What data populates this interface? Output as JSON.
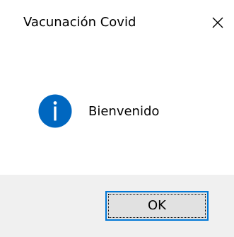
{
  "window": {
    "title": "Vacunación Covid",
    "close_glyph": "✕"
  },
  "content": {
    "icon": "info-icon",
    "message": "Bienvenido"
  },
  "footer": {
    "ok_label": "OK"
  },
  "colors": {
    "icon_fill": "#0067c0",
    "focus_border": "#0078d7",
    "footer_bg": "#f0f0f0",
    "button_bg": "#e1e1e1"
  }
}
